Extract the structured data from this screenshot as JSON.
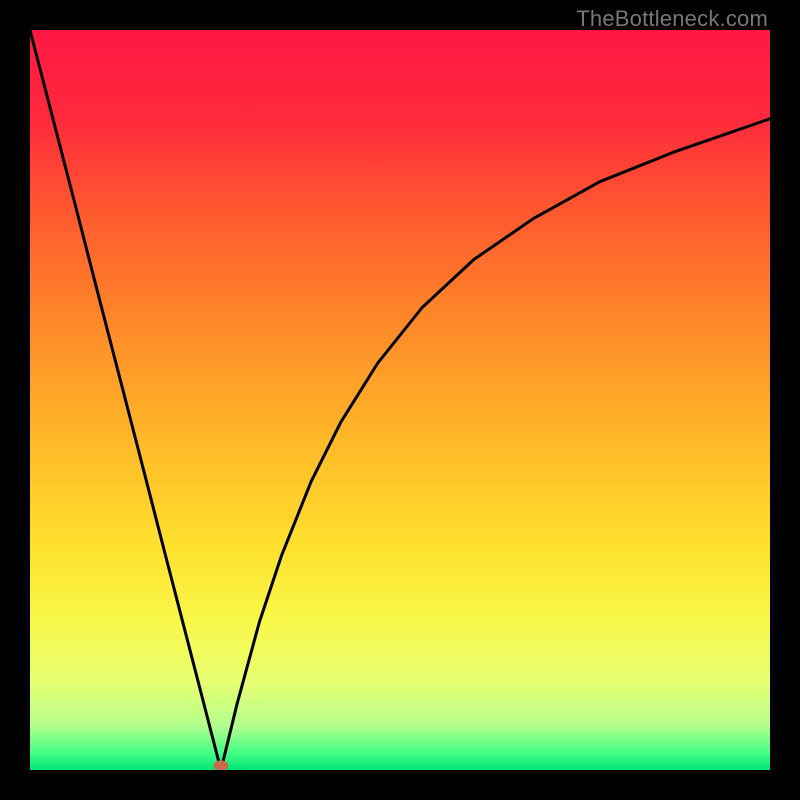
{
  "watermark": "TheBottleneck.com",
  "chart_data": {
    "type": "line",
    "title": "",
    "xlabel": "",
    "ylabel": "",
    "xlim": [
      0,
      1
    ],
    "ylim": [
      0,
      1
    ],
    "grid": false,
    "legend": false,
    "gradient_stops": [
      {
        "offset": 0.0,
        "color": "#ff1744"
      },
      {
        "offset": 0.12,
        "color": "#ff2a3c"
      },
      {
        "offset": 0.25,
        "color": "#ff5a2f"
      },
      {
        "offset": 0.4,
        "color": "#ff8a28"
      },
      {
        "offset": 0.55,
        "color": "#ffb728"
      },
      {
        "offset": 0.7,
        "color": "#ffe12e"
      },
      {
        "offset": 0.8,
        "color": "#f8f84a"
      },
      {
        "offset": 0.88,
        "color": "#e8ff70"
      },
      {
        "offset": 0.94,
        "color": "#b4ff8c"
      },
      {
        "offset": 0.975,
        "color": "#4aff88"
      },
      {
        "offset": 1.0,
        "color": "#00e676"
      }
    ],
    "series": [
      {
        "name": "left-branch",
        "x": [
          0.0,
          0.03,
          0.06,
          0.09,
          0.12,
          0.15,
          0.18,
          0.21,
          0.24,
          0.258
        ],
        "y": [
          1.0,
          0.884,
          0.768,
          0.651,
          0.535,
          0.419,
          0.302,
          0.186,
          0.07,
          0.0
        ]
      },
      {
        "name": "right-branch",
        "x": [
          0.258,
          0.28,
          0.31,
          0.34,
          0.38,
          0.42,
          0.47,
          0.53,
          0.6,
          0.68,
          0.77,
          0.87,
          1.0
        ],
        "y": [
          0.0,
          0.09,
          0.2,
          0.29,
          0.39,
          0.47,
          0.55,
          0.625,
          0.69,
          0.745,
          0.795,
          0.835,
          0.88
        ]
      }
    ],
    "marker": {
      "x": 0.258,
      "y": 0.006,
      "rx": 0.01,
      "ry": 0.007,
      "fill": "#c96a4a"
    }
  }
}
